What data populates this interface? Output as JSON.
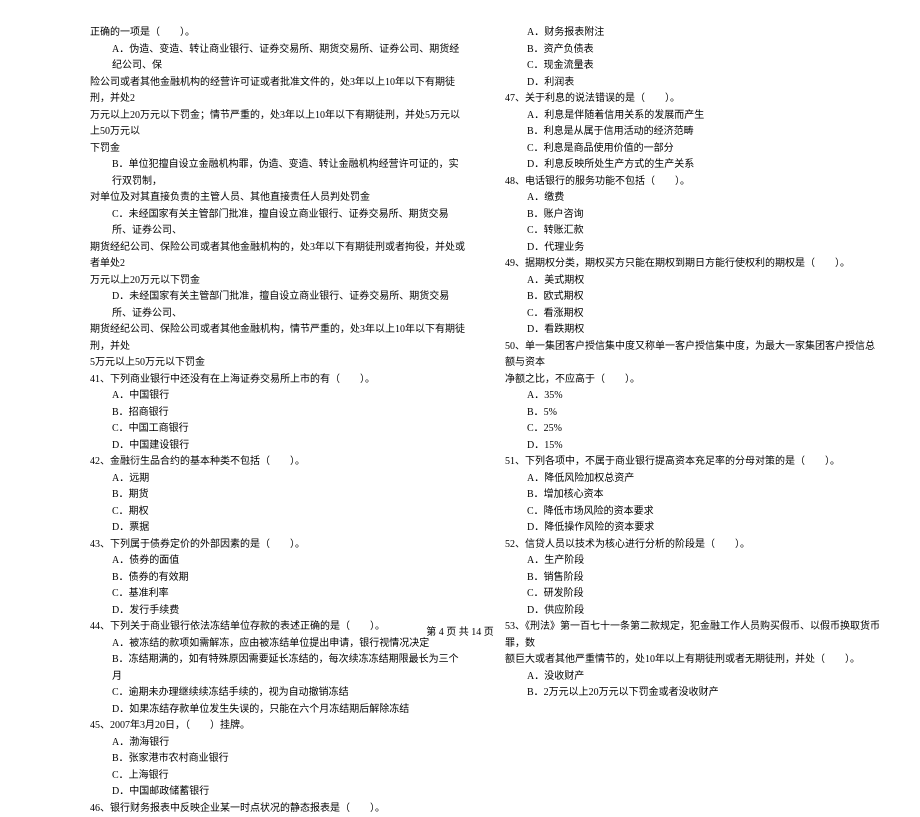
{
  "left": [
    {
      "cls": "indent0",
      "t": "正确的一项是（　　）。"
    },
    {
      "cls": "indent1",
      "t": "A．伪造、变造、转让商业银行、证券交易所、期货交易所、证券公司、期货经纪公司、保"
    },
    {
      "cls": "indent0",
      "t": "险公司或者其他金融机构的经营许可证或者批准文件的，处3年以上10年以下有期徒刑，并处2"
    },
    {
      "cls": "indent0",
      "t": "万元以上20万元以下罚金；情节严重的，处3年以上10年以下有期徒刑，并处5万元以上50万元以"
    },
    {
      "cls": "indent0",
      "t": "下罚金"
    },
    {
      "cls": "indent1",
      "t": "B．单位犯擅自设立金融机构罪，伪造、变造、转让金融机构经营许可证的，实行双罚制，"
    },
    {
      "cls": "indent0",
      "t": "对单位及对其直接负责的主管人员、其他直接责任人员判处罚金"
    },
    {
      "cls": "indent1",
      "t": "C．未经国家有关主管部门批准，擅自设立商业银行、证券交易所、期货交易所、证券公司、"
    },
    {
      "cls": "indent0",
      "t": "期货经纪公司、保险公司或者其他金融机构的，处3年以下有期徒刑或者拘役，并处或者单处2"
    },
    {
      "cls": "indent0",
      "t": "万元以上20万元以下罚金"
    },
    {
      "cls": "indent1",
      "t": "D．未经国家有关主管部门批准，擅自设立商业银行、证券交易所、期货交易所、证券公司、"
    },
    {
      "cls": "indent0",
      "t": "期货经纪公司、保险公司或者其他金融机构，情节严重的，处3年以上10年以下有期徒刑，并处"
    },
    {
      "cls": "indent0",
      "t": "5万元以上50万元以下罚金"
    },
    {
      "cls": "indent0",
      "t": "41、下列商业银行中还没有在上海证券交易所上市的有（　　）。"
    },
    {
      "cls": "indent1",
      "t": "A．中国银行"
    },
    {
      "cls": "indent1",
      "t": "B．招商银行"
    },
    {
      "cls": "indent1",
      "t": "C．中国工商银行"
    },
    {
      "cls": "indent1",
      "t": "D．中国建设银行"
    },
    {
      "cls": "indent0",
      "t": "42、金融衍生品合约的基本种类不包括（　　）。"
    },
    {
      "cls": "indent1",
      "t": "A．远期"
    },
    {
      "cls": "indent1",
      "t": "B．期货"
    },
    {
      "cls": "indent1",
      "t": "C．期权"
    },
    {
      "cls": "indent1",
      "t": "D．票据"
    },
    {
      "cls": "indent0",
      "t": "43、下列属于债券定价的外部因素的是（　　）。"
    },
    {
      "cls": "indent1",
      "t": "A．债券的面值"
    },
    {
      "cls": "indent1",
      "t": "B．债券的有效期"
    },
    {
      "cls": "indent1",
      "t": "C．基准利率"
    },
    {
      "cls": "indent1",
      "t": "D．发行手续费"
    },
    {
      "cls": "indent0",
      "t": "44、下列关于商业银行依法冻结单位存款的表述正确的是（　　）。"
    },
    {
      "cls": "indent1",
      "t": "A．被冻结的款项如需解冻，应由被冻结单位提出申请，银行视情况决定"
    },
    {
      "cls": "indent1",
      "t": "B．冻结期满的，如有特殊原因需要延长冻结的，每次续冻冻结期限最长为三个月"
    },
    {
      "cls": "indent1",
      "t": "C．逾期未办理继续续冻结手续的，视为自动撤销冻结"
    },
    {
      "cls": "indent1",
      "t": "D．如果冻结存款单位发生失误的，只能在六个月冻结期后解除冻结"
    },
    {
      "cls": "indent0",
      "t": "45、2007年3月20日，（　　）挂牌。"
    },
    {
      "cls": "indent1",
      "t": "A．渤海银行"
    },
    {
      "cls": "indent1",
      "t": "B．张家港市农村商业银行"
    },
    {
      "cls": "indent1",
      "t": "C．上海银行"
    },
    {
      "cls": "indent1",
      "t": "D．中国邮政储蓄银行"
    },
    {
      "cls": "indent0",
      "t": "46、银行财务报表中反映企业某一时点状况的静态报表是（　　）。"
    }
  ],
  "right": [
    {
      "cls": "indent1",
      "t": "A．财务报表附注"
    },
    {
      "cls": "indent1",
      "t": "B．资产负债表"
    },
    {
      "cls": "indent1",
      "t": "C．现金流量表"
    },
    {
      "cls": "indent1",
      "t": "D．利润表"
    },
    {
      "cls": "indent0",
      "t": "47、关于利息的说法错误的是（　　）。"
    },
    {
      "cls": "indent1",
      "t": "A．利息是伴随着信用关系的发展而产生"
    },
    {
      "cls": "indent1",
      "t": "B．利息是从属于信用活动的经济范畴"
    },
    {
      "cls": "indent1",
      "t": "C．利息是商品使用价值的一部分"
    },
    {
      "cls": "indent1",
      "t": "D．利息反映所处生产方式的生产关系"
    },
    {
      "cls": "indent0",
      "t": "48、电话银行的服务功能不包括（　　）。"
    },
    {
      "cls": "indent1",
      "t": "A．缴费"
    },
    {
      "cls": "indent1",
      "t": "B．账户咨询"
    },
    {
      "cls": "indent1",
      "t": "C．转账汇款"
    },
    {
      "cls": "indent1",
      "t": "D．代理业务"
    },
    {
      "cls": "indent0",
      "t": "49、据期权分类，期权买方只能在期权到期日方能行使权利的期权是（　　）。"
    },
    {
      "cls": "indent1",
      "t": "A．美式期权"
    },
    {
      "cls": "indent1",
      "t": "B．欧式期权"
    },
    {
      "cls": "indent1",
      "t": "C．看涨期权"
    },
    {
      "cls": "indent1",
      "t": "D．看跌期权"
    },
    {
      "cls": "indent0",
      "t": "50、单一集团客户授信集中度又称单一客户授信集中度，为最大一家集团客户授信总额与资本"
    },
    {
      "cls": "indent0",
      "t": "净额之比，不应高于（　　）。"
    },
    {
      "cls": "indent1",
      "t": "A．35%"
    },
    {
      "cls": "indent1",
      "t": "B．5%"
    },
    {
      "cls": "indent1",
      "t": "C．25%"
    },
    {
      "cls": "indent1",
      "t": "D．15%"
    },
    {
      "cls": "indent0",
      "t": "51、下列各项中，不属于商业银行提高资本充足率的分母对策的是（　　）。"
    },
    {
      "cls": "indent1",
      "t": "A．降低风险加权总资产"
    },
    {
      "cls": "indent1",
      "t": "B．增加核心资本"
    },
    {
      "cls": "indent1",
      "t": "C．降低市场风险的资本要求"
    },
    {
      "cls": "indent1",
      "t": "D．降低操作风险的资本要求"
    },
    {
      "cls": "indent0",
      "t": "52、信贷人员以技术为核心进行分析的阶段是（　　）。"
    },
    {
      "cls": "indent1",
      "t": "A．生产阶段"
    },
    {
      "cls": "indent1",
      "t": "B．销售阶段"
    },
    {
      "cls": "indent1",
      "t": "C．研发阶段"
    },
    {
      "cls": "indent1",
      "t": "D．供应阶段"
    },
    {
      "cls": "indent0",
      "t": "53、《刑法》第一百七十一条第二款规定，犯金融工作人员购买假币、以假币换取货币罪，数"
    },
    {
      "cls": "indent0",
      "t": "额巨大或者其他严重情节的，处10年以上有期徒刑或者无期徒刑，并处（　　）。"
    },
    {
      "cls": "indent1",
      "t": "A．没收财产"
    },
    {
      "cls": "indent1",
      "t": "B．2万元以上20万元以下罚金或者没收财产"
    }
  ],
  "footer": "第 4 页 共 14 页"
}
